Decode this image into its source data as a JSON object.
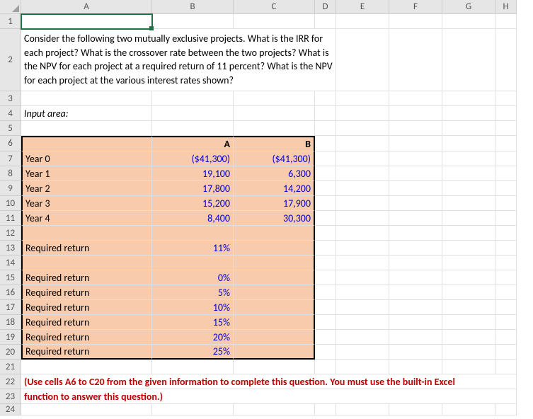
{
  "columns": [
    "A",
    "B",
    "C",
    "D",
    "E",
    "F",
    "G",
    "H"
  ],
  "rows": [
    "1",
    "2",
    "3",
    "4",
    "5",
    "6",
    "7",
    "8",
    "9",
    "10",
    "11",
    "12",
    "13",
    "14",
    "15",
    "16",
    "17",
    "18",
    "19",
    "20",
    "21",
    "22",
    "23",
    "24"
  ],
  "question": "Consider the following two mutually exclusive projects. What is the IRR for each project? What is the crossover rate between the two projects? What is the NPV for each project at a required return of 11 percent? What is the NPV for each project at the various interest rates shown?",
  "input_area_label": "Input area:",
  "table": {
    "hdrA": "A",
    "hdrB": "B",
    "r7": {
      "label": "Year 0",
      "a": "($41,300)",
      "b": "($41,300)"
    },
    "r8": {
      "label": "Year 1",
      "a": "19,100",
      "b": "6,300"
    },
    "r9": {
      "label": "Year 2",
      "a": "17,800",
      "b": "14,200"
    },
    "r10": {
      "label": "Year 3",
      "a": "15,200",
      "b": "17,900"
    },
    "r11": {
      "label": "Year 4",
      "a": "8,400",
      "b": "30,300"
    },
    "r13": {
      "label": "Required return",
      "a": "11%"
    },
    "r15": {
      "label": "Required return",
      "a": "0%"
    },
    "r16": {
      "label": "Required return",
      "a": "5%"
    },
    "r17": {
      "label": "Required return",
      "a": "10%"
    },
    "r18": {
      "label": "Required return",
      "a": "15%"
    },
    "r19": {
      "label": "Required return",
      "a": "20%"
    },
    "r20": {
      "label": "Required return",
      "a": "25%"
    }
  },
  "note1": "(Use cells A6 to C20 from the given information to complete this question. You must use the built-in Excel",
  "note2": "function to answer this question.)"
}
